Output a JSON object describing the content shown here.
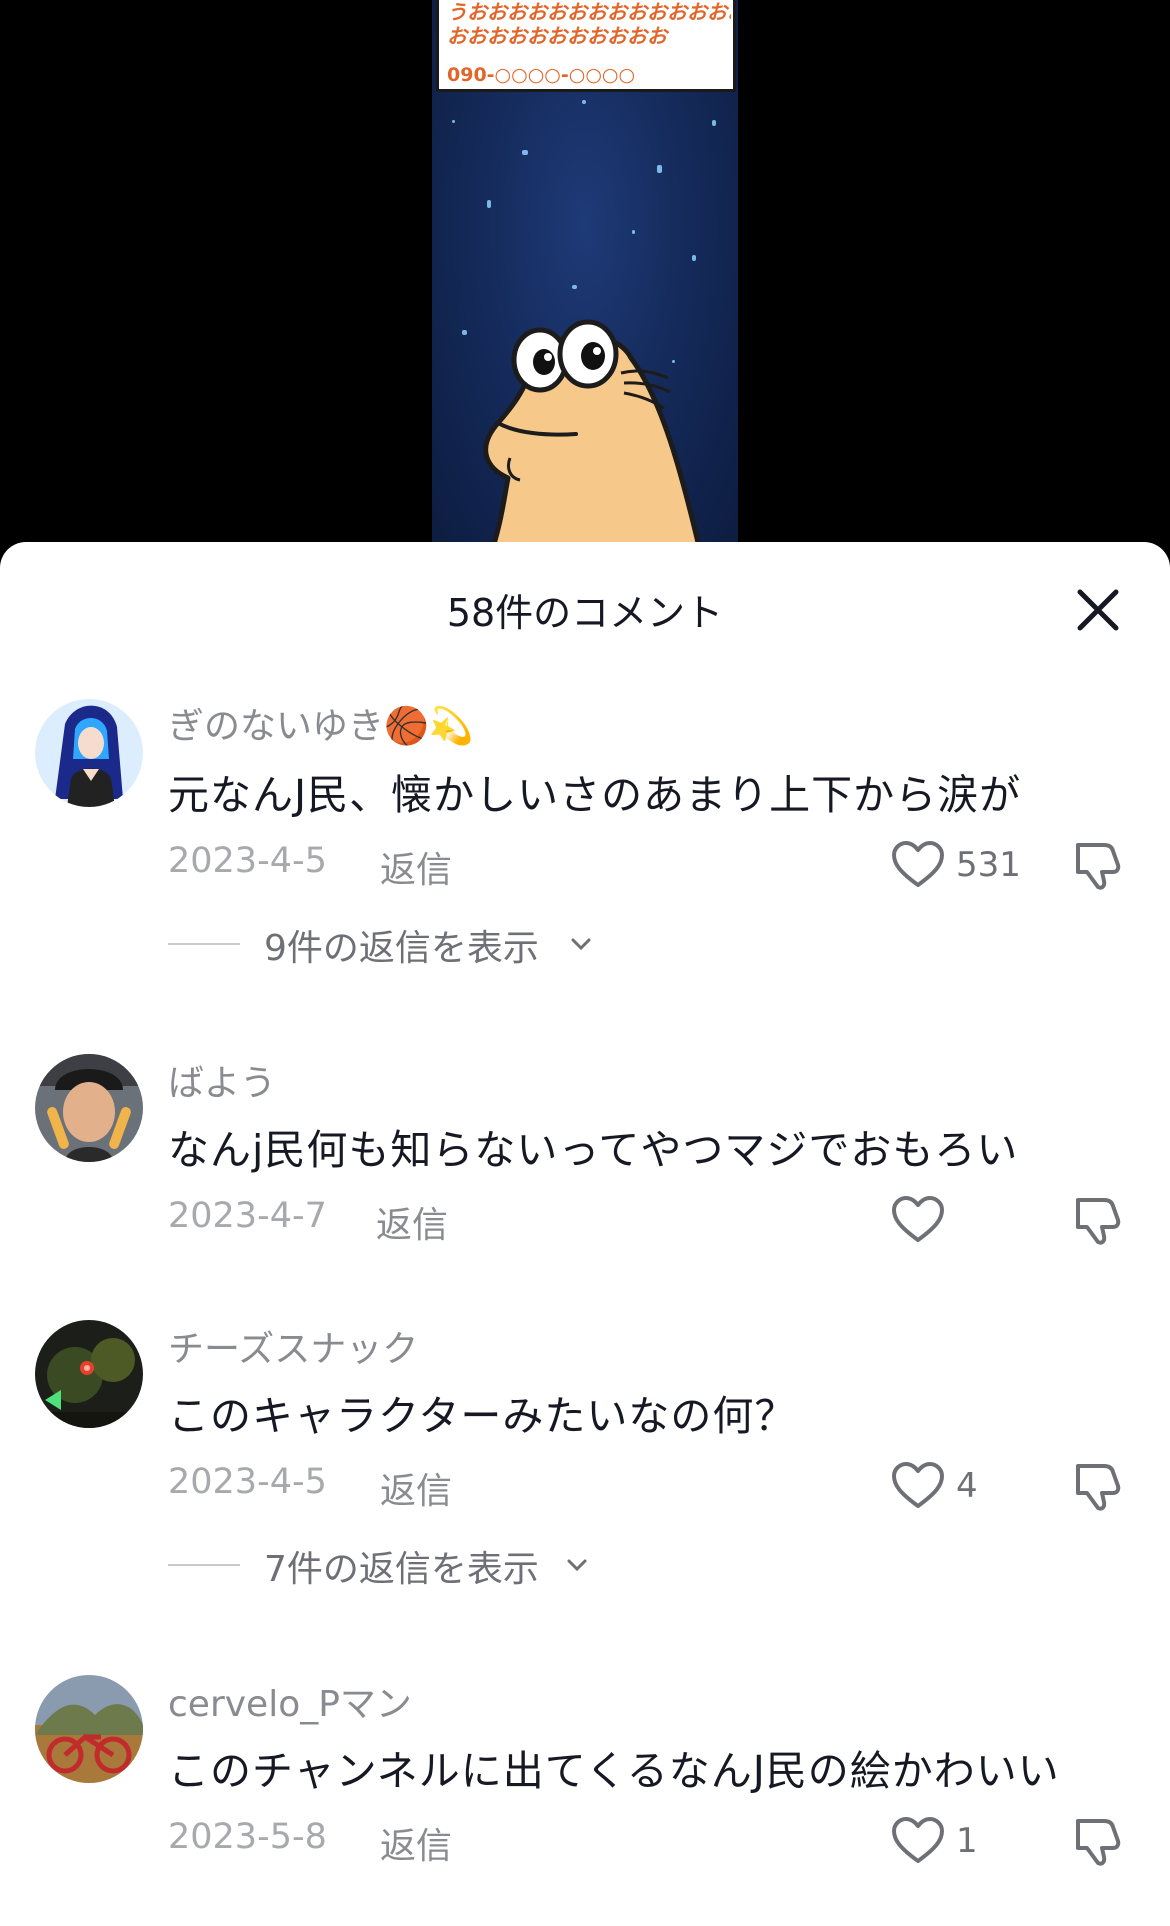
{
  "video": {
    "panel_line1": "うおおおおおおおおおおおおおお",
    "panel_line2": "おおおおおおおおおおお",
    "panel_phone": "090-○○○○-○○○○",
    "character_icon": "mole-character-illustration"
  },
  "sheet": {
    "title": "58件のコメント",
    "close_icon": "close-icon"
  },
  "comments": [
    {
      "username": "ぎのないゆき🏀💫",
      "text": "元なんJ民、懐かしいさのあまり上下から涙が",
      "date": "2023-4-5",
      "reply_label": "返信",
      "likes": "531",
      "view_replies": "9件の返信を表示"
    },
    {
      "username": "ばよう",
      "text": "なんj民何も知らないってやつマジでおもろい",
      "date": "2023-4-7",
      "reply_label": "返信",
      "likes": ""
    },
    {
      "username": "チーズスナック",
      "text": "このキャラクターみたいなの何？",
      "date": "2023-4-5",
      "reply_label": "返信",
      "likes": "4",
      "view_replies": "7件の返信を表示"
    },
    {
      "username": "cervelo_Pマン",
      "text": "このチャンネルに出てくるなんJ民の絵かわいい",
      "date": "2023-5-8",
      "reply_label": "返信",
      "likes": "1"
    }
  ],
  "colors": {
    "heading": "#161823",
    "meta": "#8a8b91",
    "date": "#a8a9ad",
    "panel_text": "#e2662a",
    "video_bg": "#152b5c"
  }
}
